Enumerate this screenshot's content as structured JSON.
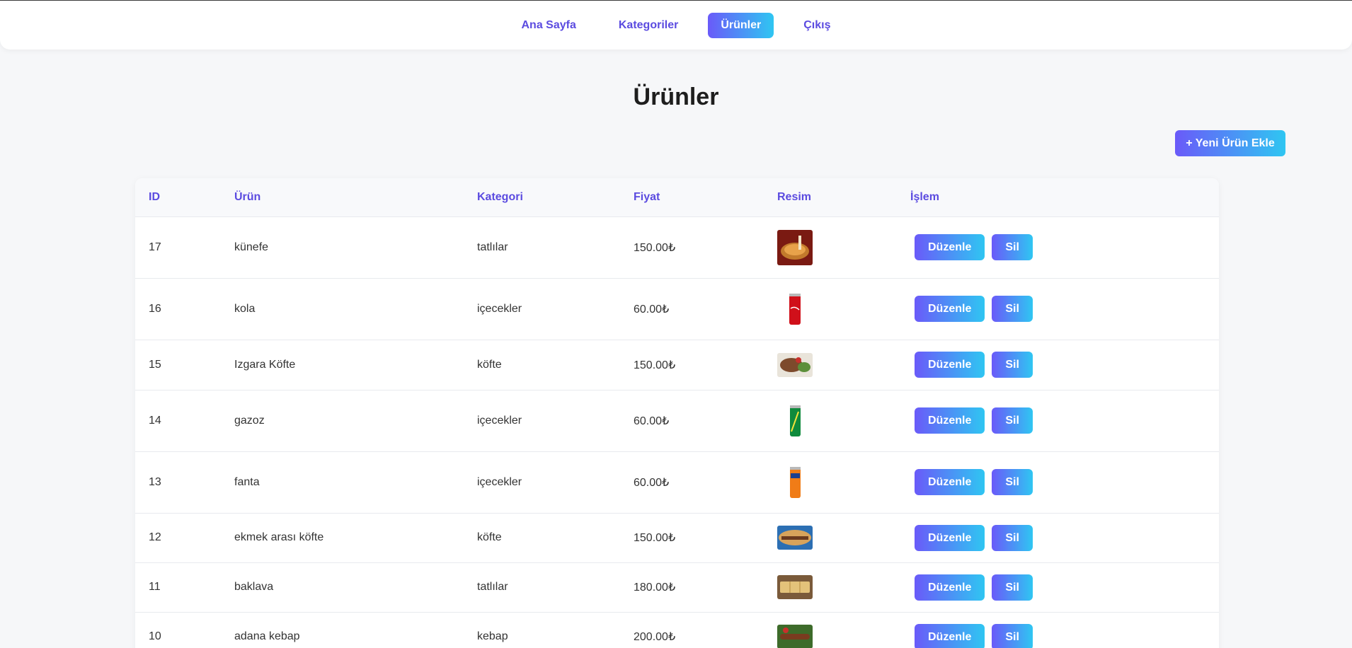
{
  "nav": {
    "items": [
      {
        "label": "Ana Sayfa",
        "active": false
      },
      {
        "label": "Kategoriler",
        "active": false
      },
      {
        "label": "Ürünler",
        "active": true
      },
      {
        "label": "Çıkış",
        "active": false
      }
    ]
  },
  "page": {
    "title": "Ürünler",
    "add_button": "+ Yeni Ürün Ekle"
  },
  "table": {
    "headers": [
      "ID",
      "Ürün",
      "Kategori",
      "Fiyat",
      "Resim",
      "İşlem"
    ],
    "edit_label": "Düzenle",
    "delete_label": "Sil",
    "rows": [
      {
        "id": "17",
        "name": "künefe",
        "category": "tatlılar",
        "price": "150.00₺",
        "image": "kunefe-image"
      },
      {
        "id": "16",
        "name": "kola",
        "category": "içecekler",
        "price": "60.00₺",
        "image": "cola-can-image"
      },
      {
        "id": "15",
        "name": "Izgara Köfte",
        "category": "köfte",
        "price": "150.00₺",
        "image": "grilled-kofte-image"
      },
      {
        "id": "14",
        "name": "gazoz",
        "category": "içecekler",
        "price": "60.00₺",
        "image": "sprite-can-image"
      },
      {
        "id": "13",
        "name": "fanta",
        "category": "içecekler",
        "price": "60.00₺",
        "image": "fanta-can-image"
      },
      {
        "id": "12",
        "name": "ekmek arası köfte",
        "category": "köfte",
        "price": "150.00₺",
        "image": "kofte-sandwich-image"
      },
      {
        "id": "11",
        "name": "baklava",
        "category": "tatlılar",
        "price": "180.00₺",
        "image": "baklava-image"
      },
      {
        "id": "10",
        "name": "adana kebap",
        "category": "kebap",
        "price": "200.00₺",
        "image": "adana-kebap-image"
      }
    ]
  },
  "colors": {
    "accent_start": "#6a5af9",
    "accent_end": "#2fc6f2",
    "link": "#5b4be0",
    "background": "#f6f7f9"
  }
}
